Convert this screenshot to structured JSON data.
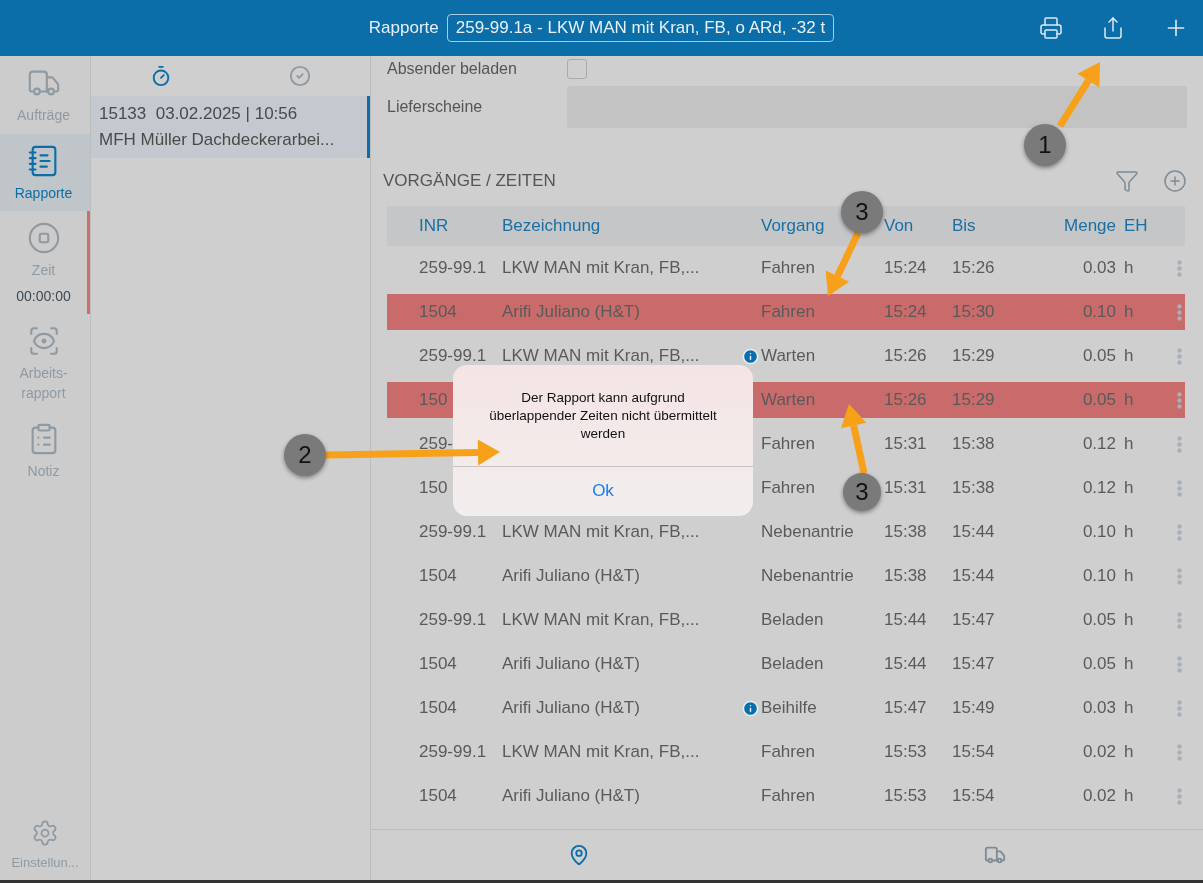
{
  "header": {
    "title": "Rapporte",
    "report_select": "259-99.1a - LKW MAN mit Kran, FB, o ARd, -32 t"
  },
  "sidebar": {
    "items": [
      {
        "kind": "truck",
        "label": "Aufträge",
        "selected": false
      },
      {
        "kind": "report",
        "label": "Rapporte",
        "selected": true
      },
      {
        "kind": "timer",
        "label": "Zeit",
        "time": "00:00:00",
        "running": true,
        "selected": false
      },
      {
        "kind": "scan",
        "label": "Arbeits-\nrapport",
        "selected": false
      },
      {
        "kind": "note",
        "label": "Notiz",
        "selected": false
      }
    ],
    "settings": "Einstellun..."
  },
  "list_tabs": [
    {
      "kind": "timer",
      "selected": true
    },
    {
      "kind": "done",
      "selected": false
    }
  ],
  "reports": [
    {
      "number": "15133",
      "date": "03.02.2025 | 10:56",
      "title": "MFH Müller Dachdeckerarbei...",
      "selected": true
    }
  ],
  "form": {
    "sender_loaded": {
      "label": "Absender beladen",
      "checked": false
    },
    "delivery_notes": {
      "label": "Lieferscheine"
    }
  },
  "section": {
    "title": "VORGÄNGE / ZEITEN"
  },
  "table": {
    "columns": [
      "INR",
      "Bezeichnung",
      "Vorgang",
      "Von",
      "Bis",
      "Menge",
      "EH"
    ],
    "rows": [
      {
        "inr": "259-99.1",
        "name": "LKW MAN mit Kran, FB,...",
        "info": false,
        "process": "Fahren",
        "from": "15:24",
        "to": "15:26",
        "qty": "0.03",
        "unit": "h",
        "overlap": false
      },
      {
        "inr": "1504",
        "name": "Arifi Juliano (H&T)",
        "info": false,
        "process": "Fahren",
        "from": "15:24",
        "to": "15:30",
        "qty": "0.10",
        "unit": "h",
        "overlap": true
      },
      {
        "inr": "259-99.1",
        "name": "LKW MAN mit Kran, FB,...",
        "info": true,
        "process": "Warten",
        "from": "15:26",
        "to": "15:29",
        "qty": "0.05",
        "unit": "h",
        "overlap": false
      },
      {
        "inr": "150",
        "info": false,
        "process": "Warten",
        "from": "15:26",
        "to": "15:29",
        "qty": "0.05",
        "unit": "h",
        "overlap": true
      },
      {
        "inr": "259-",
        "info": false,
        "process": "Fahren",
        "from": "15:31",
        "to": "15:38",
        "qty": "0.12",
        "unit": "h",
        "overlap": false
      },
      {
        "inr": "150",
        "info": false,
        "process": "Fahren",
        "from": "15:31",
        "to": "15:38",
        "qty": "0.12",
        "unit": "h",
        "overlap": false
      },
      {
        "inr": "259-99.1",
        "name": "LKW MAN mit Kran, FB,...",
        "info": false,
        "process": "Nebenantrie",
        "from": "15:38",
        "to": "15:44",
        "qty": "0.10",
        "unit": "h",
        "overlap": false
      },
      {
        "inr": "1504",
        "name": "Arifi Juliano (H&T)",
        "info": false,
        "process": "Nebenantrie",
        "from": "15:38",
        "to": "15:44",
        "qty": "0.10",
        "unit": "h",
        "overlap": false
      },
      {
        "inr": "259-99.1",
        "name": "LKW MAN mit Kran, FB,...",
        "info": false,
        "process": "Beladen",
        "from": "15:44",
        "to": "15:47",
        "qty": "0.05",
        "unit": "h",
        "overlap": false
      },
      {
        "inr": "1504",
        "name": "Arifi Juliano (H&T)",
        "info": false,
        "process": "Beladen",
        "from": "15:44",
        "to": "15:47",
        "qty": "0.05",
        "unit": "h",
        "overlap": false
      },
      {
        "inr": "1504",
        "name": "Arifi Juliano (H&T)",
        "info": true,
        "process": "Beihilfe",
        "from": "15:47",
        "to": "15:49",
        "qty": "0.03",
        "unit": "h",
        "overlap": false
      },
      {
        "inr": "259-99.1",
        "name": "LKW MAN mit Kran, FB,...",
        "info": false,
        "process": "Fahren",
        "from": "15:53",
        "to": "15:54",
        "qty": "0.02",
        "unit": "h",
        "overlap": false
      },
      {
        "inr": "1504",
        "name": "Arifi Juliano (H&T)",
        "info": false,
        "process": "Fahren",
        "from": "15:53",
        "to": "15:54",
        "qty": "0.02",
        "unit": "h",
        "overlap": false
      }
    ]
  },
  "bottom_tabs": [
    {
      "kind": "location",
      "selected": true
    },
    {
      "kind": "truck",
      "selected": false
    }
  ],
  "dialog": {
    "message": "Der Rapport kann aufgrund überlappender Zeiten nicht übermittelt werden",
    "button": "Ok"
  },
  "callouts": [
    {
      "number": "1"
    },
    {
      "number": "2"
    },
    {
      "number": "3"
    },
    {
      "number": "3"
    }
  ]
}
